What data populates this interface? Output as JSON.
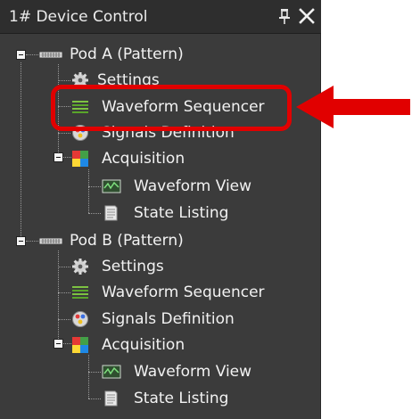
{
  "panel": {
    "title": "1# Device Control",
    "pin_icon": "pin-icon",
    "close_icon": "close-icon"
  },
  "tree": {
    "pod_a": {
      "label": "Pod A (Pattern)",
      "icon": "pod-connector-icon",
      "children": {
        "settings": {
          "label": "Settings",
          "icon": "gear-icon"
        },
        "waveform_sequencer": {
          "label": "Waveform Sequencer",
          "icon": "sequencer-icon"
        },
        "signals_definition": {
          "label": "Signals Definition",
          "icon": "signals-icon"
        },
        "acquisition": {
          "label": "Acquisition",
          "icon": "acquisition-icon",
          "children": {
            "waveform_view": {
              "label": "Waveform View",
              "icon": "waveform-view-icon"
            },
            "state_listing": {
              "label": "State Listing",
              "icon": "state-listing-icon"
            }
          }
        }
      }
    },
    "pod_b": {
      "label": "Pod B (Pattern)",
      "icon": "pod-connector-icon",
      "children": {
        "settings": {
          "label": "Settings",
          "icon": "gear-icon"
        },
        "waveform_sequencer": {
          "label": "Waveform Sequencer",
          "icon": "sequencer-icon"
        },
        "signals_definition": {
          "label": "Signals Definition",
          "icon": "signals-icon"
        },
        "acquisition": {
          "label": "Acquisition",
          "icon": "acquisition-icon",
          "children": {
            "waveform_view": {
              "label": "Waveform View",
              "icon": "waveform-view-icon"
            },
            "state_listing": {
              "label": "State Listing",
              "icon": "state-listing-icon"
            }
          }
        }
      }
    }
  },
  "annotation": {
    "highlight_color": "#e10000",
    "target": "Waveform Sequencer"
  }
}
